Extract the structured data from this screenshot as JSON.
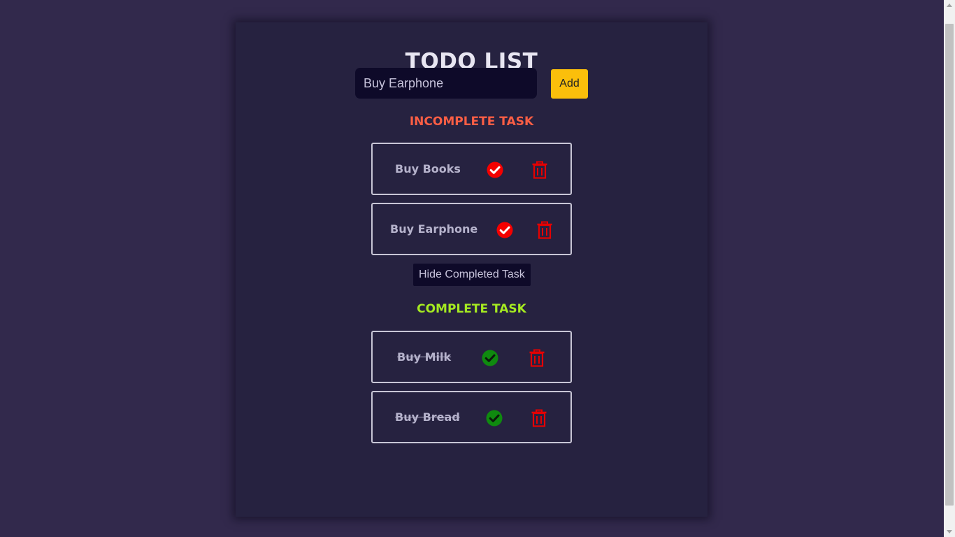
{
  "app": {
    "title": "TODO LIST"
  },
  "input": {
    "value": "Buy Earphone"
  },
  "add_label": "Add",
  "incomplete": {
    "heading": "INCOMPLETE TASK",
    "tasks": [
      {
        "label": "Buy Books"
      },
      {
        "label": "Buy Earphone"
      }
    ]
  },
  "hide_completed_label": "Hide Completed Task",
  "complete": {
    "heading": "COMPLETE TASK",
    "tasks": [
      {
        "label": "Buy Milk"
      },
      {
        "label": "Buy Bread"
      }
    ]
  },
  "icons": {
    "check_incomplete": "check-circle-icon",
    "check_complete": "check-circle-icon",
    "delete": "trash-icon"
  },
  "colors": {
    "page_bg": "#32294c",
    "card_bg": "#262240",
    "input_bg": "#0e0a29",
    "add_button": "#fbbf0b",
    "incomplete_heading": "#fb5e45",
    "complete_heading": "#a5ea21",
    "check_incomplete": "#f40000",
    "check_complete": "#0f8a0f",
    "trash": "#e60000"
  }
}
